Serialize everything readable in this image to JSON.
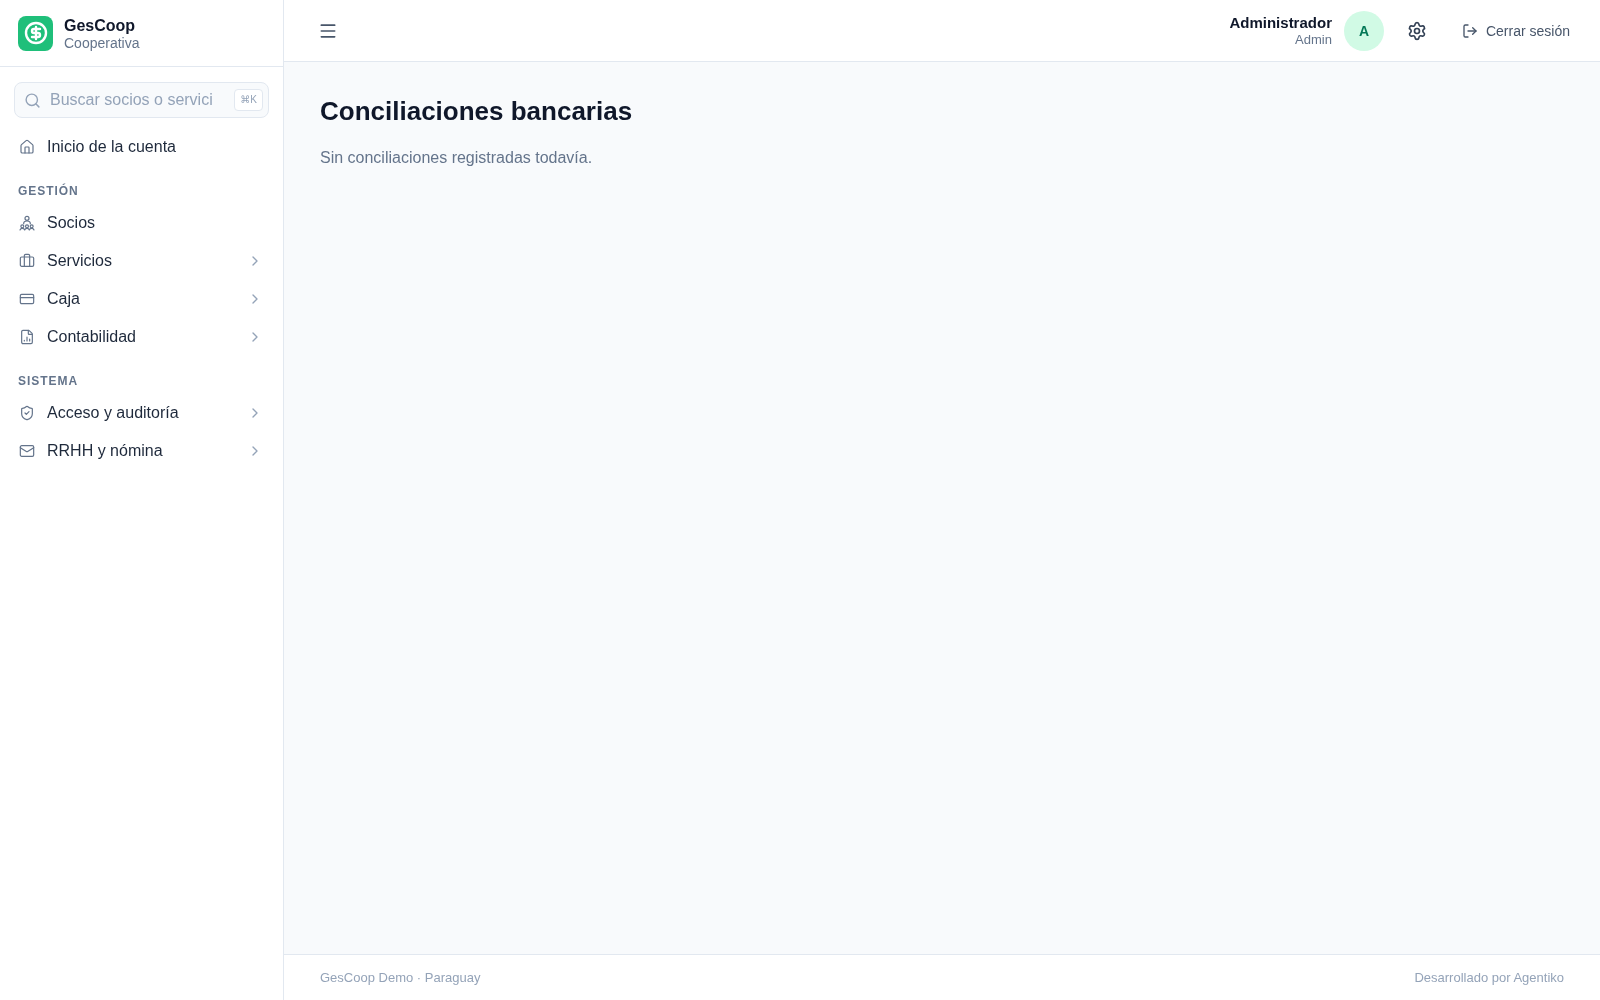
{
  "brand": {
    "name": "GesCoop",
    "subtitle": "Cooperativa"
  },
  "search": {
    "placeholder": "Buscar socios o servici",
    "shortcut": "⌘K"
  },
  "sidebar": {
    "items": [
      {
        "label": "Inicio de la cuenta",
        "has_submenu": false
      }
    ],
    "sections": [
      {
        "title": "GESTIÓN",
        "items": [
          {
            "label": "Socios",
            "has_submenu": false
          },
          {
            "label": "Servicios",
            "has_submenu": true
          },
          {
            "label": "Caja",
            "has_submenu": true
          },
          {
            "label": "Contabilidad",
            "has_submenu": true
          }
        ]
      },
      {
        "title": "SISTEMA",
        "items": [
          {
            "label": "Acceso y auditoría",
            "has_submenu": true
          },
          {
            "label": "RRHH y nómina",
            "has_submenu": true
          }
        ]
      }
    ]
  },
  "header": {
    "user": {
      "name": "Administrador",
      "role": "Admin",
      "initial": "A"
    },
    "logout": "Cerrar sesión"
  },
  "page": {
    "title": "Conciliaciones bancarias",
    "empty_message": "Sin conciliaciones registradas todavía."
  },
  "footer": {
    "left": "GesCoop Demo · Paraguay",
    "right": "Desarrollado por Agentiko"
  }
}
